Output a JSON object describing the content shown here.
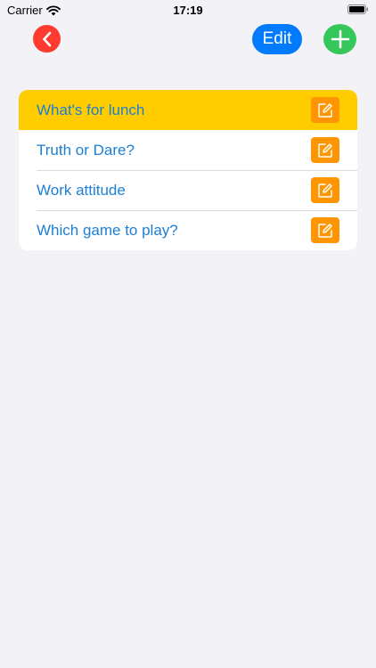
{
  "status_bar": {
    "carrier": "Carrier",
    "time": "17:19"
  },
  "nav": {
    "edit_label": "Edit"
  },
  "list": {
    "items": [
      {
        "label": "What's for lunch",
        "selected": true
      },
      {
        "label": "Truth or Dare?",
        "selected": false
      },
      {
        "label": "Work attitude",
        "selected": false
      },
      {
        "label": "Which game to play?",
        "selected": false
      }
    ]
  },
  "colors": {
    "background": "#F2F2F7",
    "back": "#FF3B30",
    "edit": "#007AFF",
    "add": "#34C759",
    "selected_row": "#FFCC00",
    "row_edit": "#FF9500",
    "row_text": "#1C7FD4"
  },
  "icons": {
    "back": "chevron-left-icon",
    "add": "plus-icon",
    "row_edit": "square-pencil-icon",
    "wifi": "wifi-icon",
    "battery": "battery-icon"
  }
}
